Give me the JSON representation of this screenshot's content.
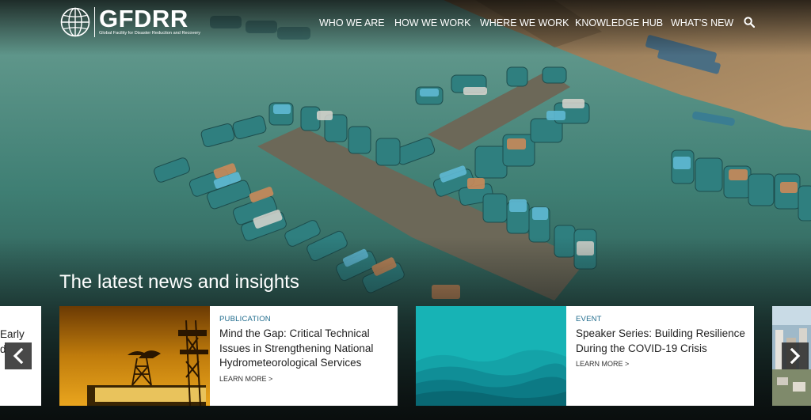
{
  "brand": {
    "name": "GFDRR",
    "tagline": "Global Facility for Disaster Reduction and Recovery"
  },
  "nav": {
    "items": [
      "WHO WE ARE",
      "HOW WE WORK",
      "WHERE WE WORK",
      "KNOWLEDGE HUB",
      "WHAT'S NEW"
    ],
    "search_icon": "search-icon"
  },
  "section": {
    "title": "The latest news and insights"
  },
  "carousel": {
    "partial_left_text": "Early\nd",
    "cards": [
      {
        "tag": "PUBLICATION",
        "title": "Mind the Gap: Critical Technical Issues in Strengthening National Hydrometeorological Services",
        "more": "LEARN MORE >",
        "image": "weather-station-photo"
      },
      {
        "tag": "EVENT",
        "title": "Speaker Series: Building Resilience During the COVID-19 Crisis",
        "more": "LEARN MORE >",
        "image": "teal-waves-graphic"
      }
    ],
    "prev_icon": "chevron-left-icon",
    "next_icon": "chevron-right-icon"
  },
  "colors": {
    "accent_tag": "#1f6b8c",
    "water": "#3f7f74",
    "card_bg": "#ffffff"
  }
}
